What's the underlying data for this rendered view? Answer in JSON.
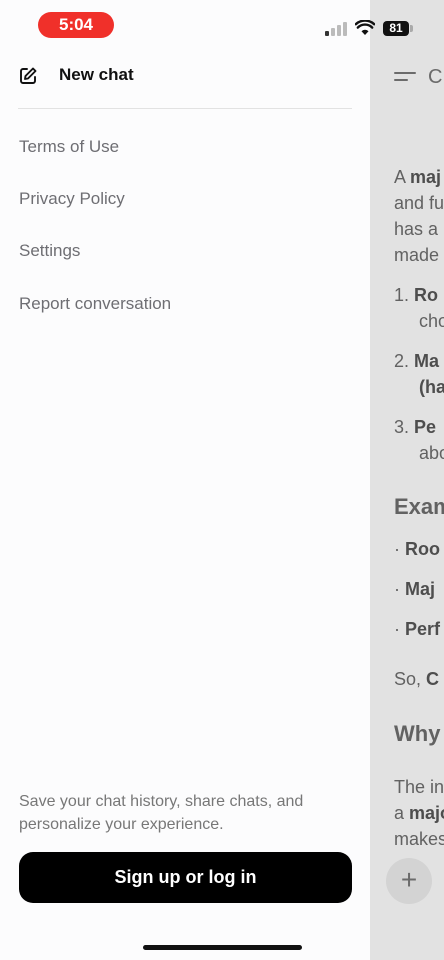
{
  "status_bar": {
    "time": "5:04",
    "battery": "81"
  },
  "drawer": {
    "new_chat_label": "New chat",
    "links": {
      "terms": "Terms of Use",
      "privacy": "Privacy Policy",
      "settings": "Settings",
      "report": "Report conversation"
    },
    "save_prompt": "Save your chat history, share chats, and personalize your experience.",
    "signup_label": "Sign up or log in"
  },
  "background": {
    "title": "C",
    "para1_a": "A ",
    "para1_b": "maj",
    "para1_line2": "and fu",
    "para1_line3": "has a",
    "para1_line4": "made",
    "list1_num": "1.",
    "list1_a": "Ro",
    "list1_b": "cho",
    "list2_num": "2.",
    "list2_a": "Ma",
    "list2_b": "(ha",
    "list3_num": "3.",
    "list3_a": "Pe",
    "list3_b": "abo",
    "heading_examples": "Exam",
    "bullet1": "Roo",
    "bullet2": "Maj",
    "bullet3": "Perf",
    "so_a": "So, ",
    "so_b": "C",
    "heading_why": "Why",
    "para2_line1": "The in",
    "para2_line2_a": "a ",
    "para2_line2_b": "majo",
    "para2_line3": "makes"
  }
}
